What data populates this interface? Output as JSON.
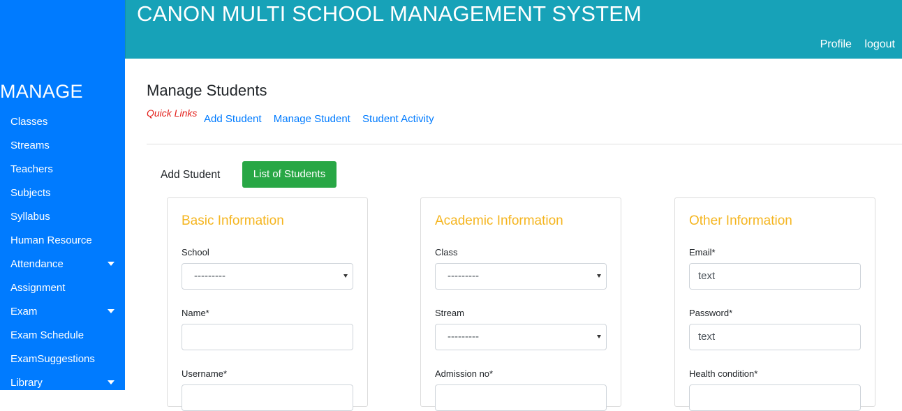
{
  "header": {
    "title": "CANON MULTI SCHOOL MANAGEMENT SYSTEM",
    "profile": "Profile",
    "logout": "logout"
  },
  "sidebar": {
    "heading": "MANAGE",
    "items": [
      {
        "label": "Classes",
        "dropdown": false
      },
      {
        "label": "Streams",
        "dropdown": false
      },
      {
        "label": "Teachers",
        "dropdown": false
      },
      {
        "label": "Subjects",
        "dropdown": false
      },
      {
        "label": "Syllabus",
        "dropdown": false
      },
      {
        "label": "Human Resource",
        "dropdown": false
      },
      {
        "label": "Attendance",
        "dropdown": true
      },
      {
        "label": "Assignment",
        "dropdown": false
      },
      {
        "label": "Exam",
        "dropdown": true
      },
      {
        "label": "Exam Schedule",
        "dropdown": false
      },
      {
        "label": "ExamSuggestions",
        "dropdown": false
      },
      {
        "label": "Library",
        "dropdown": true
      }
    ]
  },
  "main": {
    "title": "Manage Students",
    "quick_links_label": "Quick Links",
    "quick_links": [
      "Add Student",
      "Manage Student",
      "Student Activity"
    ],
    "tabs": {
      "add": "Add Student",
      "list": "List of Students"
    },
    "cards": {
      "basic": {
        "title": "Basic Information",
        "school_label": "School",
        "school_value": "---------",
        "name_label": "Name*",
        "name_value": "",
        "username_label": "Username*"
      },
      "academic": {
        "title": "Academic Information",
        "class_label": "Class",
        "class_value": "---------",
        "stream_label": "Stream",
        "stream_value": "---------",
        "admission_label": "Admission no*"
      },
      "other": {
        "title": "Other Information",
        "email_label": "Email*",
        "email_value": "text",
        "password_label": "Password*",
        "password_value": "text",
        "health_label": "Health condition*"
      }
    }
  },
  "colors": {
    "sidebar": "#007bff",
    "header": "#17a2b8",
    "accent_green": "#28a745",
    "card_title": "#f5b51f",
    "quick_links_label": "#e3201b"
  }
}
